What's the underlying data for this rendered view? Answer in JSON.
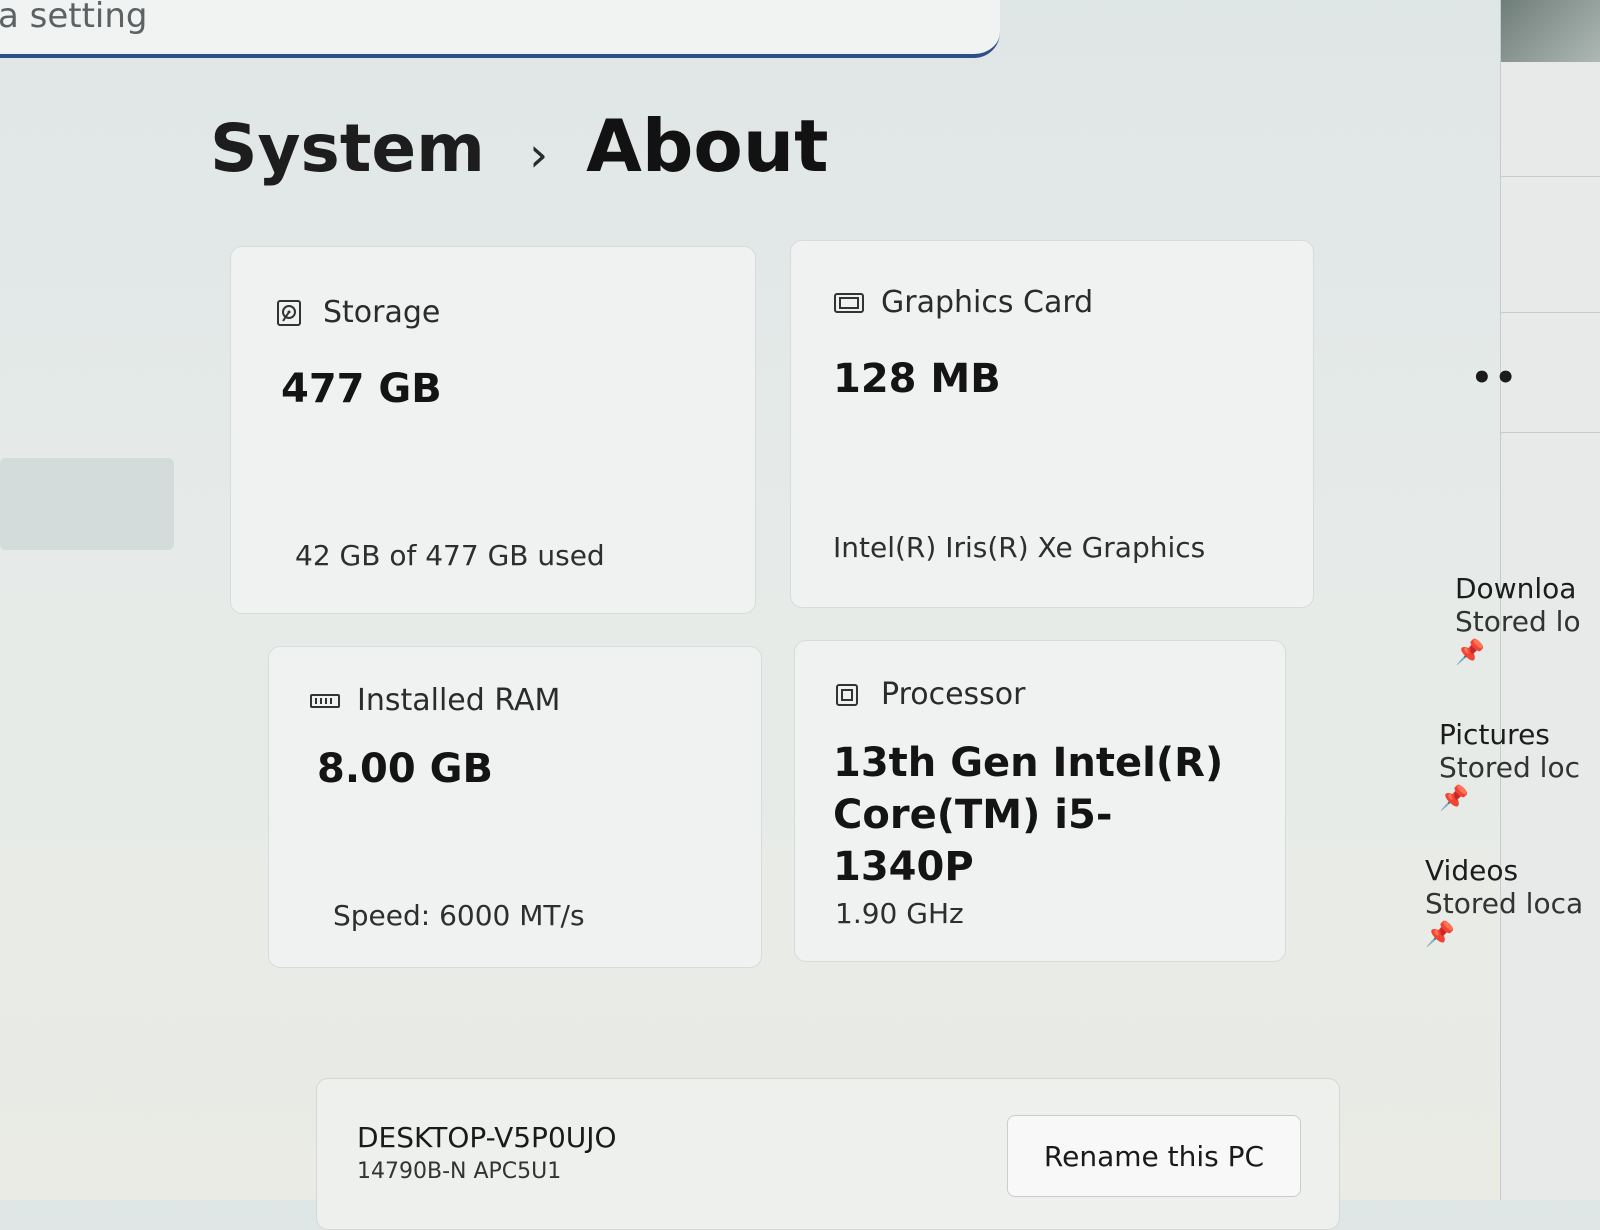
{
  "search": {
    "placeholder": "a setting"
  },
  "breadcrumb": {
    "parent": "System",
    "separator": "›",
    "current": "About"
  },
  "cards": {
    "storage": {
      "title": "Storage",
      "value": "477 GB",
      "detail": "42 GB of 477 GB used"
    },
    "graphics": {
      "title": "Graphics Card",
      "value": "128 MB",
      "detail": "Intel(R) Iris(R) Xe Graphics"
    },
    "ram": {
      "title": "Installed RAM",
      "value": "8.00 GB",
      "detail": "Speed: 6000 MT/s"
    },
    "processor": {
      "title": "Processor",
      "value_line1": "13th Gen Intel(R)",
      "value_line2": "Core(TM) i5-1340P",
      "detail": "1.90 GHz"
    }
  },
  "device": {
    "name": "DESKTOP-V5P0UJO",
    "model": "14790B-N APC5U1",
    "rename_label": "Rename this PC"
  },
  "right_panel": {
    "more": "••",
    "items": [
      {
        "title": "Downloa",
        "subtitle": "Stored lo"
      },
      {
        "title": "Pictures",
        "subtitle": "Stored loc"
      },
      {
        "title": "Videos",
        "subtitle": "Stored loca"
      }
    ]
  },
  "icons": {
    "storage": "hard-drive-icon",
    "graphics": "graphics-card-icon",
    "ram": "memory-icon",
    "processor": "cpu-icon",
    "pin": "pin-icon"
  }
}
